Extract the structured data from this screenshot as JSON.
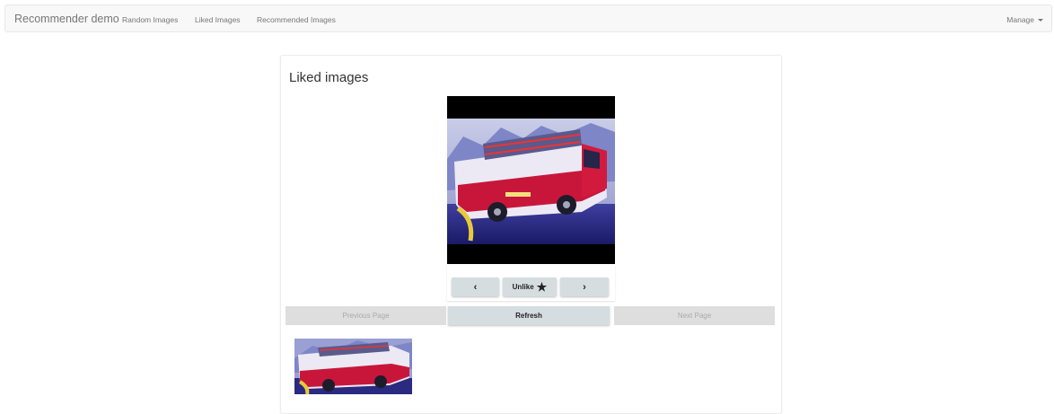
{
  "navbar": {
    "brand": "Recommender demo",
    "links": [
      "Random Images",
      "Liked Images",
      "Recommended Images"
    ],
    "manage_label": "Manage"
  },
  "card": {
    "title": "Liked images",
    "viewer": {
      "image_subject": "fire truck",
      "prev_label": "‹",
      "unlike_label": "Unlike",
      "unlike_icon": "star-icon",
      "next_label": "›"
    },
    "pagination": {
      "previous_label": "Previous Page",
      "refresh_label": "Refresh",
      "next_label": "Next Page"
    },
    "thumbnails": [
      {
        "subject": "fire truck"
      }
    ]
  },
  "colors": {
    "navbar_bg": "#f8f8f8",
    "button_bg": "#d6dde1",
    "disabled_bg": "#dedede"
  }
}
